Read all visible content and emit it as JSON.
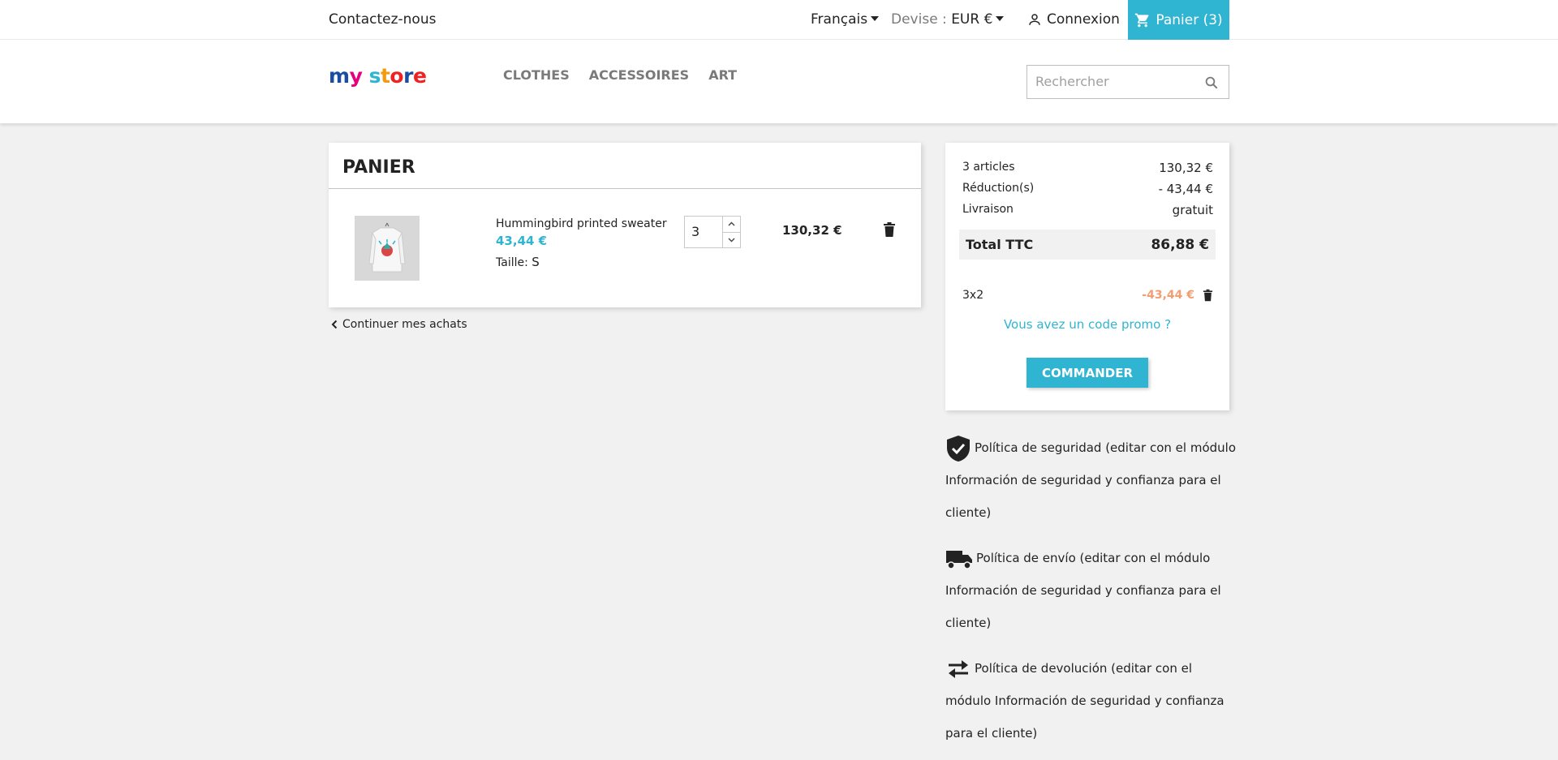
{
  "topnav": {
    "contact": "Contactez-nous",
    "language": "Français",
    "currency_label": "Devise :",
    "currency_value": "EUR €",
    "login": "Connexion",
    "cart": "Panier (3)"
  },
  "header": {
    "logo": {
      "w1": "m",
      "w2": "y",
      "w3": " ",
      "w4": "s",
      "w5": "t",
      "w6": "o",
      "w7": "r",
      "w8": "e"
    },
    "menu": [
      "CLOTHES",
      "ACCESSOIRES",
      "ART"
    ],
    "search_placeholder": "Rechercher"
  },
  "cart": {
    "title": "PANIER",
    "item": {
      "name": "Hummingbird printed sweater",
      "price": "43,44 €",
      "size_label": "Taille:",
      "size_value": "S",
      "quantity": "3",
      "line_total": "130,32 €"
    },
    "continue": "Continuer mes achats"
  },
  "summary": {
    "articles_label": "3 articles",
    "articles_value": "130,32 €",
    "reduction_label": "Réduction(s)",
    "reduction_value": "- 43,44 €",
    "shipping_label": "Livraison",
    "shipping_value": "gratuit",
    "total_label": "Total TTC",
    "total_value": "86,88 €",
    "voucher_name": "3x2",
    "voucher_amount": "-43,44 €",
    "promo_link": "Vous avez un code promo ?",
    "order_button": "COMMANDER"
  },
  "reassurance": [
    {
      "icon": "shield-check-icon",
      "text": "Política de seguridad (editar con el módulo Información de seguridad y confianza para el cliente)"
    },
    {
      "icon": "truck-icon",
      "text": "Política de envío (editar con el módulo Información de seguridad y confianza para el cliente)"
    },
    {
      "icon": "swap-arrows-icon",
      "text": "Política de devolución (editar con el módulo Información de seguridad y confianza para el cliente)"
    }
  ],
  "colors": {
    "accent": "#2fb5d2",
    "discount": "#f39d72"
  }
}
